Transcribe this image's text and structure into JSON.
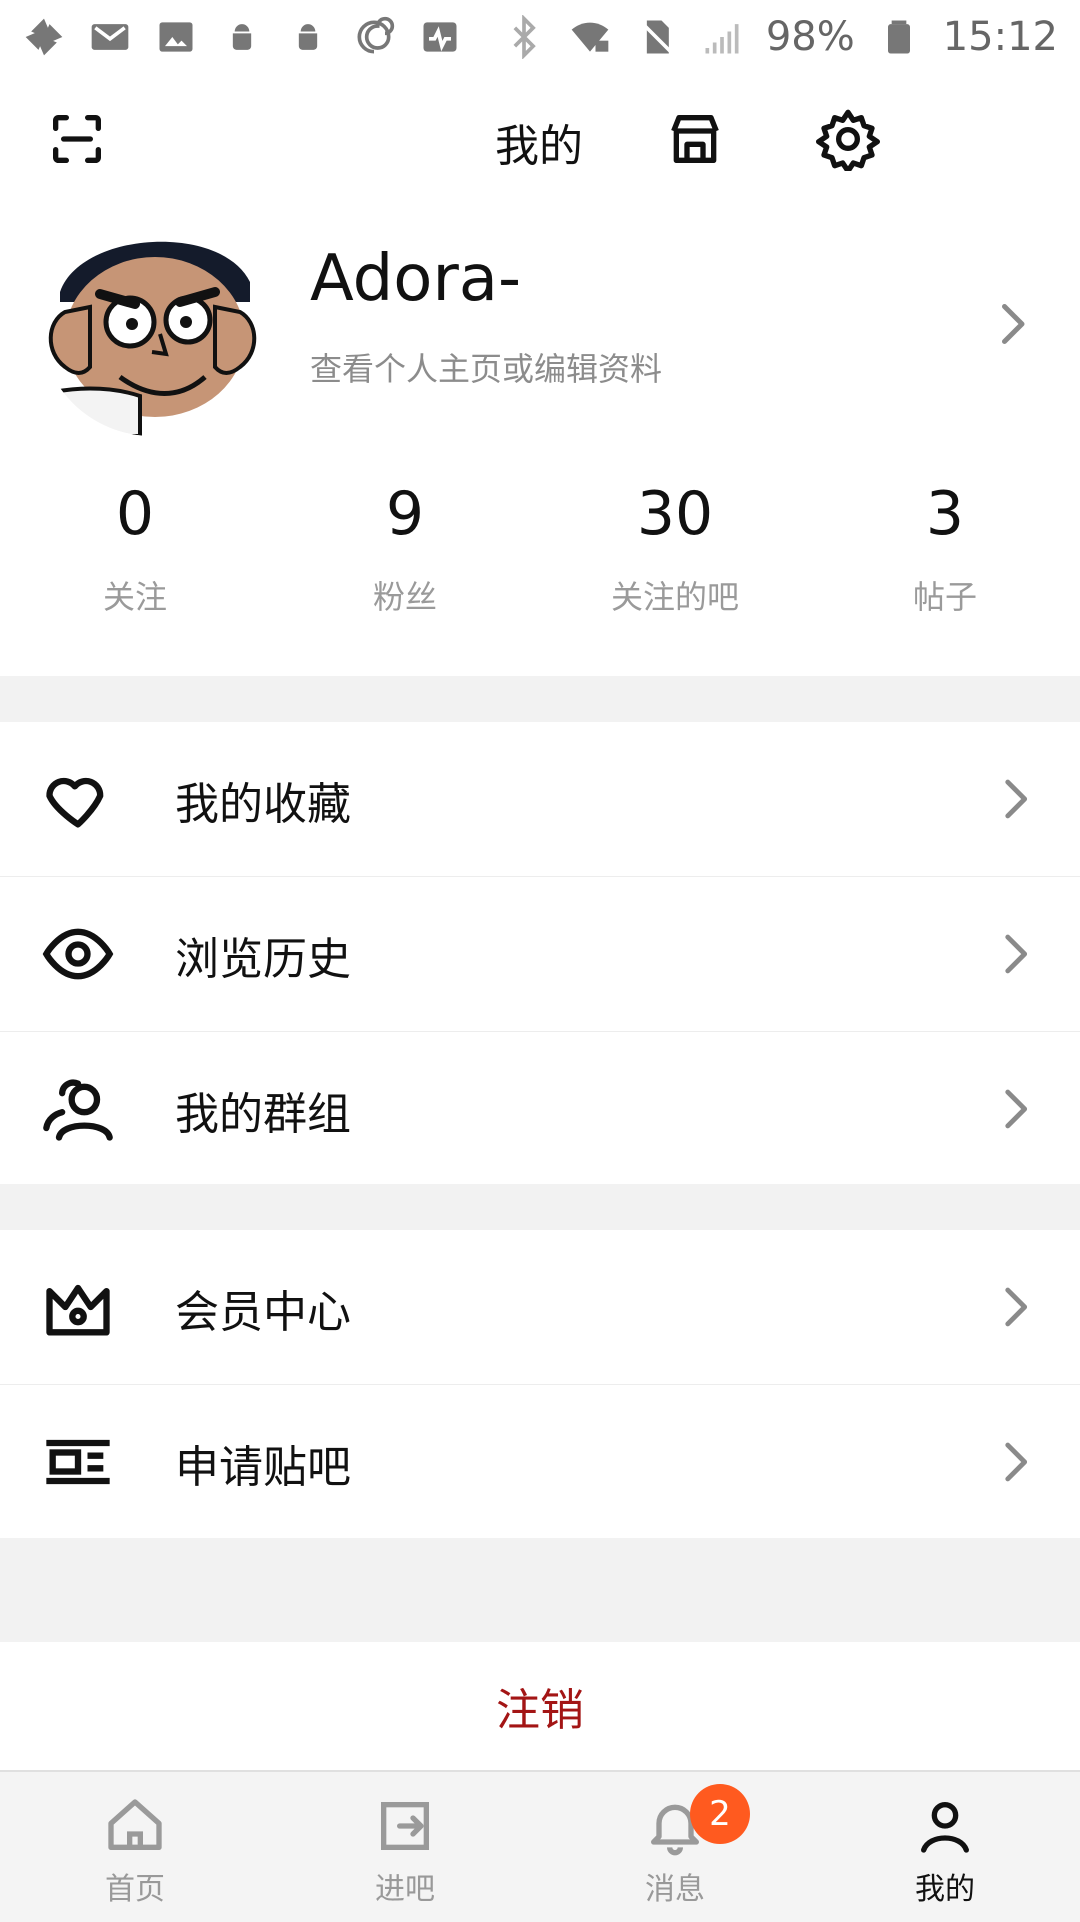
{
  "status_bar": {
    "battery_percent": "98%",
    "time": "15:12"
  },
  "header": {
    "title": "我的"
  },
  "profile": {
    "username": "Adora-",
    "subtitle": "查看个人主页或编辑资料",
    "stats": [
      {
        "value": "0",
        "label": "关注"
      },
      {
        "value": "9",
        "label": "粉丝"
      },
      {
        "value": "30",
        "label": "关注的吧"
      },
      {
        "value": "3",
        "label": "帖子"
      }
    ]
  },
  "menu": {
    "group1": [
      {
        "label": "我的收藏",
        "icon": "heart-icon"
      },
      {
        "label": "浏览历史",
        "icon": "eye-icon"
      },
      {
        "label": "我的群组",
        "icon": "group-icon"
      }
    ],
    "group2": [
      {
        "label": "会员中心",
        "icon": "crown-icon"
      },
      {
        "label": "申请贴吧",
        "icon": "apply-bar-icon"
      }
    ]
  },
  "logout": {
    "label": "注销",
    "color": "#a31515"
  },
  "bottom_nav": {
    "items": [
      {
        "label": "首页",
        "icon": "home-icon",
        "active": false
      },
      {
        "label": "进吧",
        "icon": "enter-icon",
        "active": false
      },
      {
        "label": "消息",
        "icon": "bell-icon",
        "active": false,
        "badge": "2"
      },
      {
        "label": "我的",
        "icon": "person-icon",
        "active": true
      }
    ],
    "badge_color": "#ff5a1f"
  }
}
